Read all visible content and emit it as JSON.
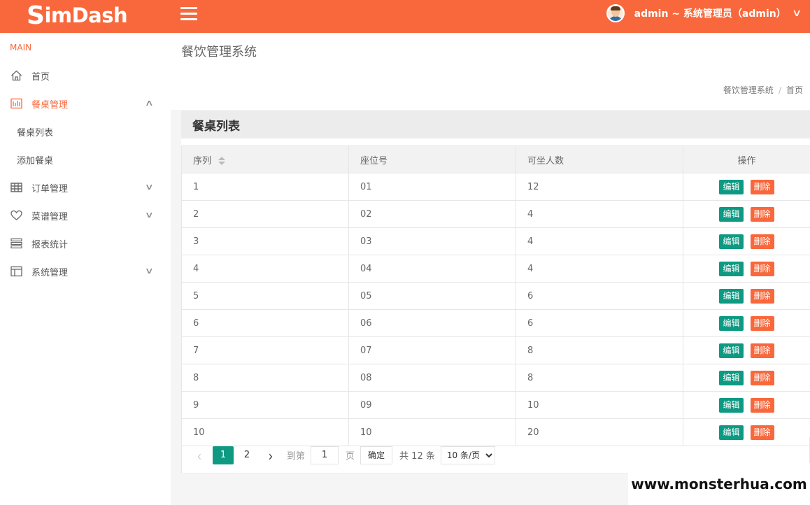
{
  "header": {
    "logo_first": "S",
    "logo_rest": "imDash",
    "user_label": "admin ~ 系统管理员（admin）"
  },
  "sidebar": {
    "section": "MAIN",
    "items": [
      {
        "label": "首页",
        "icon": "home-icon"
      },
      {
        "label": "餐桌管理",
        "icon": "table-icon",
        "active": true,
        "expanded": true,
        "children": [
          {
            "label": "餐桌列表"
          },
          {
            "label": "添加餐桌"
          }
        ]
      },
      {
        "label": "订单管理",
        "icon": "grid-icon"
      },
      {
        "label": "菜谱管理",
        "icon": "heart-icon"
      },
      {
        "label": "报表统计",
        "icon": "list-icon"
      },
      {
        "label": "系统管理",
        "icon": "layout-icon"
      }
    ]
  },
  "page": {
    "title": "餐饮管理系统",
    "breadcrumb": [
      "餐饮管理系统",
      "首页"
    ]
  },
  "card": {
    "title": "餐桌列表",
    "columns": [
      "序列",
      "座位号",
      "可坐人数",
      "操作"
    ],
    "rows": [
      {
        "id": "1",
        "seat": "01",
        "capacity": "12"
      },
      {
        "id": "2",
        "seat": "02",
        "capacity": "4"
      },
      {
        "id": "3",
        "seat": "03",
        "capacity": "4"
      },
      {
        "id": "4",
        "seat": "04",
        "capacity": "4"
      },
      {
        "id": "5",
        "seat": "05",
        "capacity": "6"
      },
      {
        "id": "6",
        "seat": "06",
        "capacity": "6"
      },
      {
        "id": "7",
        "seat": "07",
        "capacity": "8"
      },
      {
        "id": "8",
        "seat": "08",
        "capacity": "8"
      },
      {
        "id": "9",
        "seat": "09",
        "capacity": "10"
      },
      {
        "id": "10",
        "seat": "10",
        "capacity": "20"
      }
    ],
    "edit_label": "编辑",
    "delete_label": "删除"
  },
  "pager": {
    "pages": [
      "1",
      "2"
    ],
    "current": "1",
    "goto_prefix": "到第",
    "goto_value": "1",
    "goto_suffix": "页",
    "confirm": "确定",
    "total": "共 12 条",
    "page_size": "10 条/页"
  },
  "colors": {
    "brand": "#f8683c",
    "accent": "#0e9a82"
  },
  "watermark": "www.monsterhua.com"
}
